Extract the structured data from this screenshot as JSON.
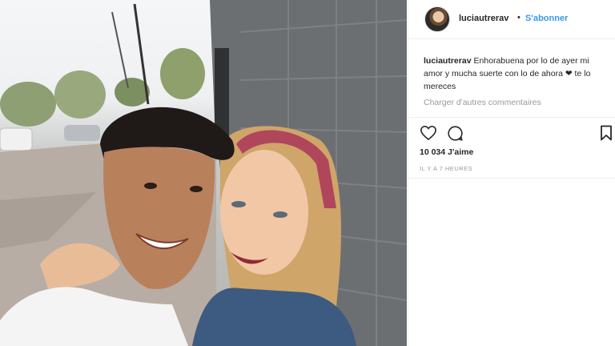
{
  "post": {
    "username": "luciautrerav",
    "separator": "•",
    "follow_label": "S'abonner",
    "caption_username": "luciautrerav",
    "caption_text": "Enhorabuena por lo de ayer mi amor y mucha suerte con lo de ahora ❤ te lo mereces",
    "load_more_label": "Charger d'autres commentaires",
    "likes_label": "10 034 J'aime",
    "timestamp": "IL Y A 7 HEURES"
  },
  "icons": {
    "like": "heart-outline-icon",
    "comment": "speech-bubble-icon",
    "save": "bookmark-icon"
  },
  "colors": {
    "link_blue": "#3897f0",
    "text": "#262626",
    "muted": "#999999"
  }
}
